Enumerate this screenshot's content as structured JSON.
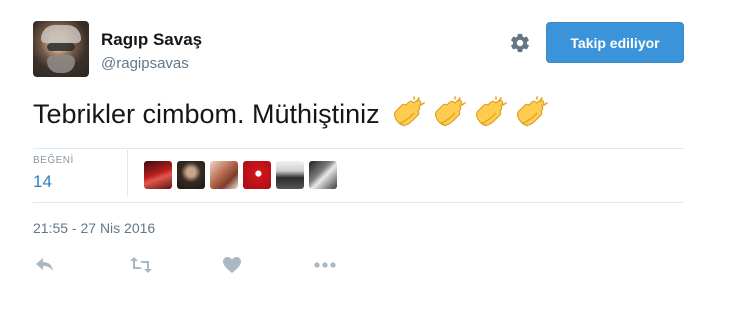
{
  "user": {
    "name": "Ragıp Savaş",
    "handle": "@ragipsavas"
  },
  "follow_button": {
    "label": "Takip ediliyor"
  },
  "tweet": {
    "text": "Tebrikler cimbom. Müthiştiniz",
    "emoji_icons": [
      "clapping-hands-icon",
      "clapping-hands-icon",
      "clapping-hands-icon",
      "clapping-hands-icon"
    ]
  },
  "stats": {
    "likes_label": "BEĞENİ",
    "likes_count": "14"
  },
  "likers": [
    "avatar-1",
    "avatar-2",
    "avatar-3",
    "avatar-4",
    "avatar-5",
    "avatar-6"
  ],
  "timestamp": "21:55 - 27 Nis 2016",
  "actions": [
    "reply-icon",
    "retweet-icon",
    "like-icon",
    "more-icon"
  ],
  "colors": {
    "accent": "#3b94d9",
    "likes": "#2a81c6",
    "muted": "#657786",
    "emoji": "#ffcc4d",
    "icon": "#aab8c2"
  }
}
